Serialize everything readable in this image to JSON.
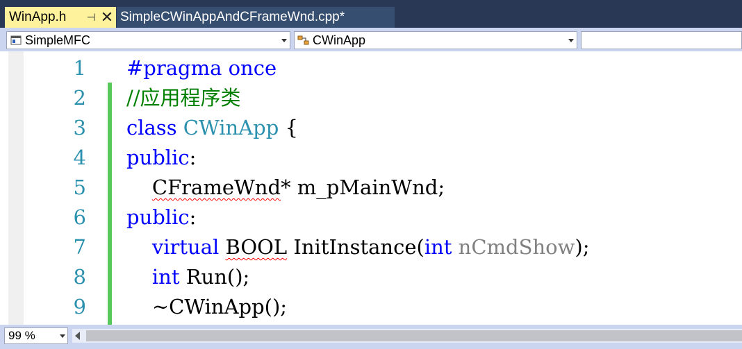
{
  "tabs": {
    "active": {
      "label": "WinApp.h",
      "pin_glyph": "⊣",
      "close_glyph": "✕"
    },
    "inactive": {
      "label": "SimpleCWinAppAndCFrameWnd.cpp*"
    }
  },
  "navbar": {
    "project": {
      "value": "SimpleMFC"
    },
    "class": {
      "value": "CWinApp"
    },
    "member": {
      "value": ""
    }
  },
  "editor": {
    "lines": [
      {
        "n": "1",
        "tokens": [
          {
            "t": "#pragma once",
            "c": "kw"
          }
        ]
      },
      {
        "n": "2",
        "tokens": [
          {
            "t": "//应用程序类",
            "c": "cm"
          }
        ]
      },
      {
        "n": "3",
        "tokens": [
          {
            "t": "class ",
            "c": "kw"
          },
          {
            "t": "CWinApp",
            "c": "ty"
          },
          {
            "t": " {",
            "c": ""
          }
        ]
      },
      {
        "n": "4",
        "tokens": [
          {
            "t": "public",
            "c": "kw"
          },
          {
            "t": ":",
            "c": ""
          }
        ]
      },
      {
        "n": "5",
        "tokens": [
          {
            "t": "    ",
            "c": ""
          },
          {
            "t": "CFrameWnd",
            "c": "err"
          },
          {
            "t": "* m_pMainWnd;",
            "c": ""
          }
        ]
      },
      {
        "n": "6",
        "tokens": [
          {
            "t": "public",
            "c": "kw"
          },
          {
            "t": ":",
            "c": ""
          }
        ]
      },
      {
        "n": "7",
        "tokens": [
          {
            "t": "    ",
            "c": ""
          },
          {
            "t": "virtual",
            "c": "kw"
          },
          {
            "t": " ",
            "c": ""
          },
          {
            "t": "BOOL",
            "c": "err"
          },
          {
            "t": " InitInstance(",
            "c": ""
          },
          {
            "t": "int",
            "c": "kw"
          },
          {
            "t": " ",
            "c": ""
          },
          {
            "t": "nCmdShow",
            "c": "pm"
          },
          {
            "t": ");",
            "c": ""
          }
        ]
      },
      {
        "n": "8",
        "tokens": [
          {
            "t": "    ",
            "c": ""
          },
          {
            "t": "int",
            "c": "kw"
          },
          {
            "t": " Run();",
            "c": ""
          }
        ]
      },
      {
        "n": "9",
        "tokens": [
          {
            "t": "    ~CWinApp();",
            "c": ""
          }
        ]
      }
    ]
  },
  "status": {
    "zoom": "99 %"
  },
  "colors": {
    "keyword": "#0000ff",
    "comment": "#008000",
    "type": "#2b91af",
    "parameter": "#808080",
    "line_number": "#2b91af",
    "change_bar": "#57c95b",
    "active_tab": "#fff29d"
  },
  "icons": {
    "project": "project-icon",
    "class": "class-icon",
    "member": "member-icon"
  }
}
